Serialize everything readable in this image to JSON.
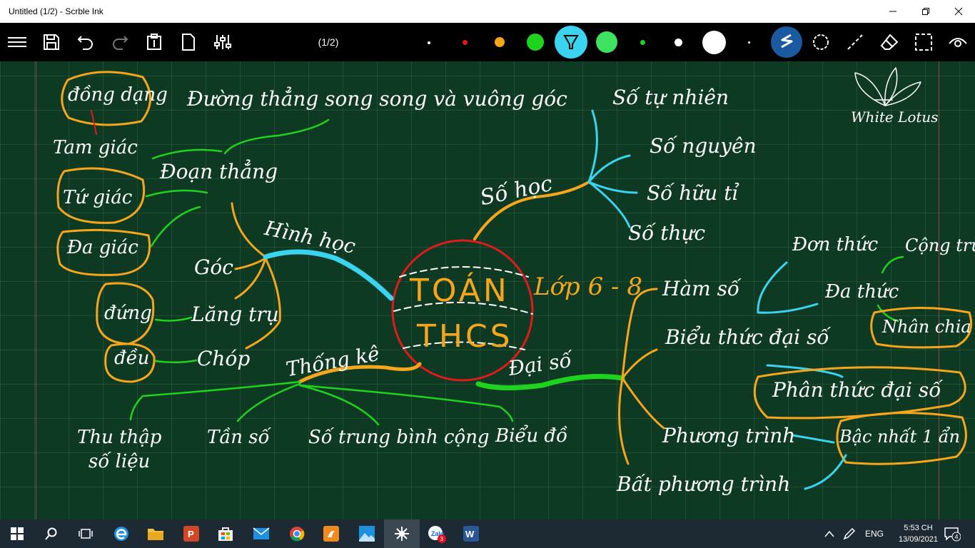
{
  "window": {
    "title": "Untitled (1/2) - Scrble Ink"
  },
  "toolbar": {
    "page_indicator": "(1/2)",
    "colors": {
      "red": "#e01b1b",
      "orange": "#f6a61c",
      "green": "#1ed31e",
      "cyan": "#3ad3f0",
      "white": "#ffffff",
      "blue": "#1a5aa0"
    }
  },
  "canvas": {
    "center": {
      "line1": "TOÁN",
      "line2": "THCS",
      "grade": "Lớp 6 - 8"
    },
    "labels": {
      "dong_dang": "đồng dạng",
      "song_song": "Đường thẳng song song và vuông góc",
      "tam_giac": "Tam giác",
      "doan_thang": "Đoạn thẳng",
      "tu_giac": "Tứ giác",
      "da_giac": "Đa giác",
      "hinh_hoc": "Hình học",
      "goc": "Góc",
      "dung": "đứng",
      "lang_tru": "Lăng trụ",
      "deu": "đều",
      "chop": "Chóp",
      "thong_ke": "Thống kê",
      "thu_thap": "Thu thập",
      "so_lieu": "số liệu",
      "tan_so": "Tần số",
      "so_tb": "Số trung bình cộng",
      "bieu_do": "Biểu đồ",
      "so_hoc": "Số học",
      "so_tu_nhien": "Số tự nhiên",
      "so_nguyen": "Số nguyên",
      "so_huu_ti": "Số hữu tỉ",
      "so_thuc": "Số thực",
      "dai_so": "Đại số",
      "ham_so": "Hàm số",
      "bieu_thuc": "Biểu thức đại số",
      "phuong_trinh": "Phương trình",
      "bat_pt": "Bất phương trình",
      "don_thuc": "Đơn thức",
      "cong_tru": "Cộng trừ",
      "da_thuc": "Đa thức",
      "nhan_chia": "Nhân chia",
      "phan_thuc": "Phân thức đại số",
      "bac_nhat": "Bậc nhất 1 ẩn",
      "logo": "White Lotus"
    }
  },
  "taskbar": {
    "lang": "ENG",
    "time": "5:53 CH",
    "date": "13/09/2021",
    "notif_count": "4",
    "zalo_badge": "3"
  }
}
